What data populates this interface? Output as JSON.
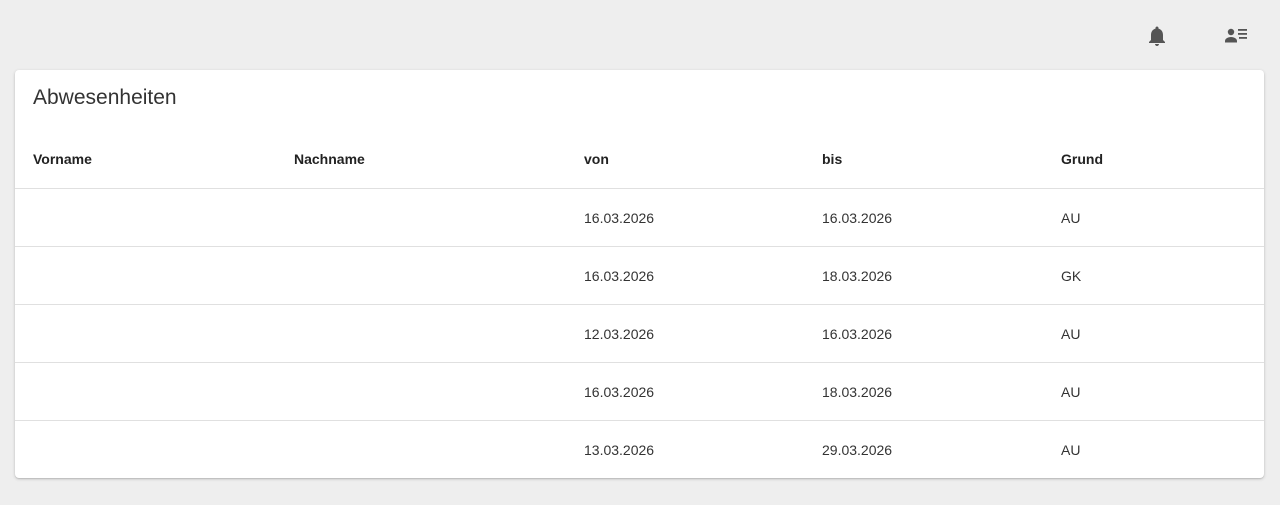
{
  "header": {
    "icons": [
      "bell-icon",
      "person-list-icon"
    ]
  },
  "card": {
    "title": "Abwesenheiten"
  },
  "table": {
    "columns": [
      "Vorname",
      "Nachname",
      "von",
      "bis",
      "Grund"
    ],
    "rows": [
      {
        "vorname": "",
        "nachname": "",
        "von": "16.03.2026",
        "bis": "16.03.2026",
        "grund": "AU"
      },
      {
        "vorname": "",
        "nachname": "",
        "von": "16.03.2026",
        "bis": "18.03.2026",
        "grund": "GK"
      },
      {
        "vorname": "",
        "nachname": "",
        "von": "12.03.2026",
        "bis": "16.03.2026",
        "grund": "AU"
      },
      {
        "vorname": "",
        "nachname": "",
        "von": "16.03.2026",
        "bis": "18.03.2026",
        "grund": "AU"
      },
      {
        "vorname": "",
        "nachname": "",
        "von": "13.03.2026",
        "bis": "29.03.2026",
        "grund": "AU"
      }
    ]
  },
  "colors": {
    "background": "#eeeeee",
    "card": "#ffffff",
    "icon": "#555555"
  }
}
